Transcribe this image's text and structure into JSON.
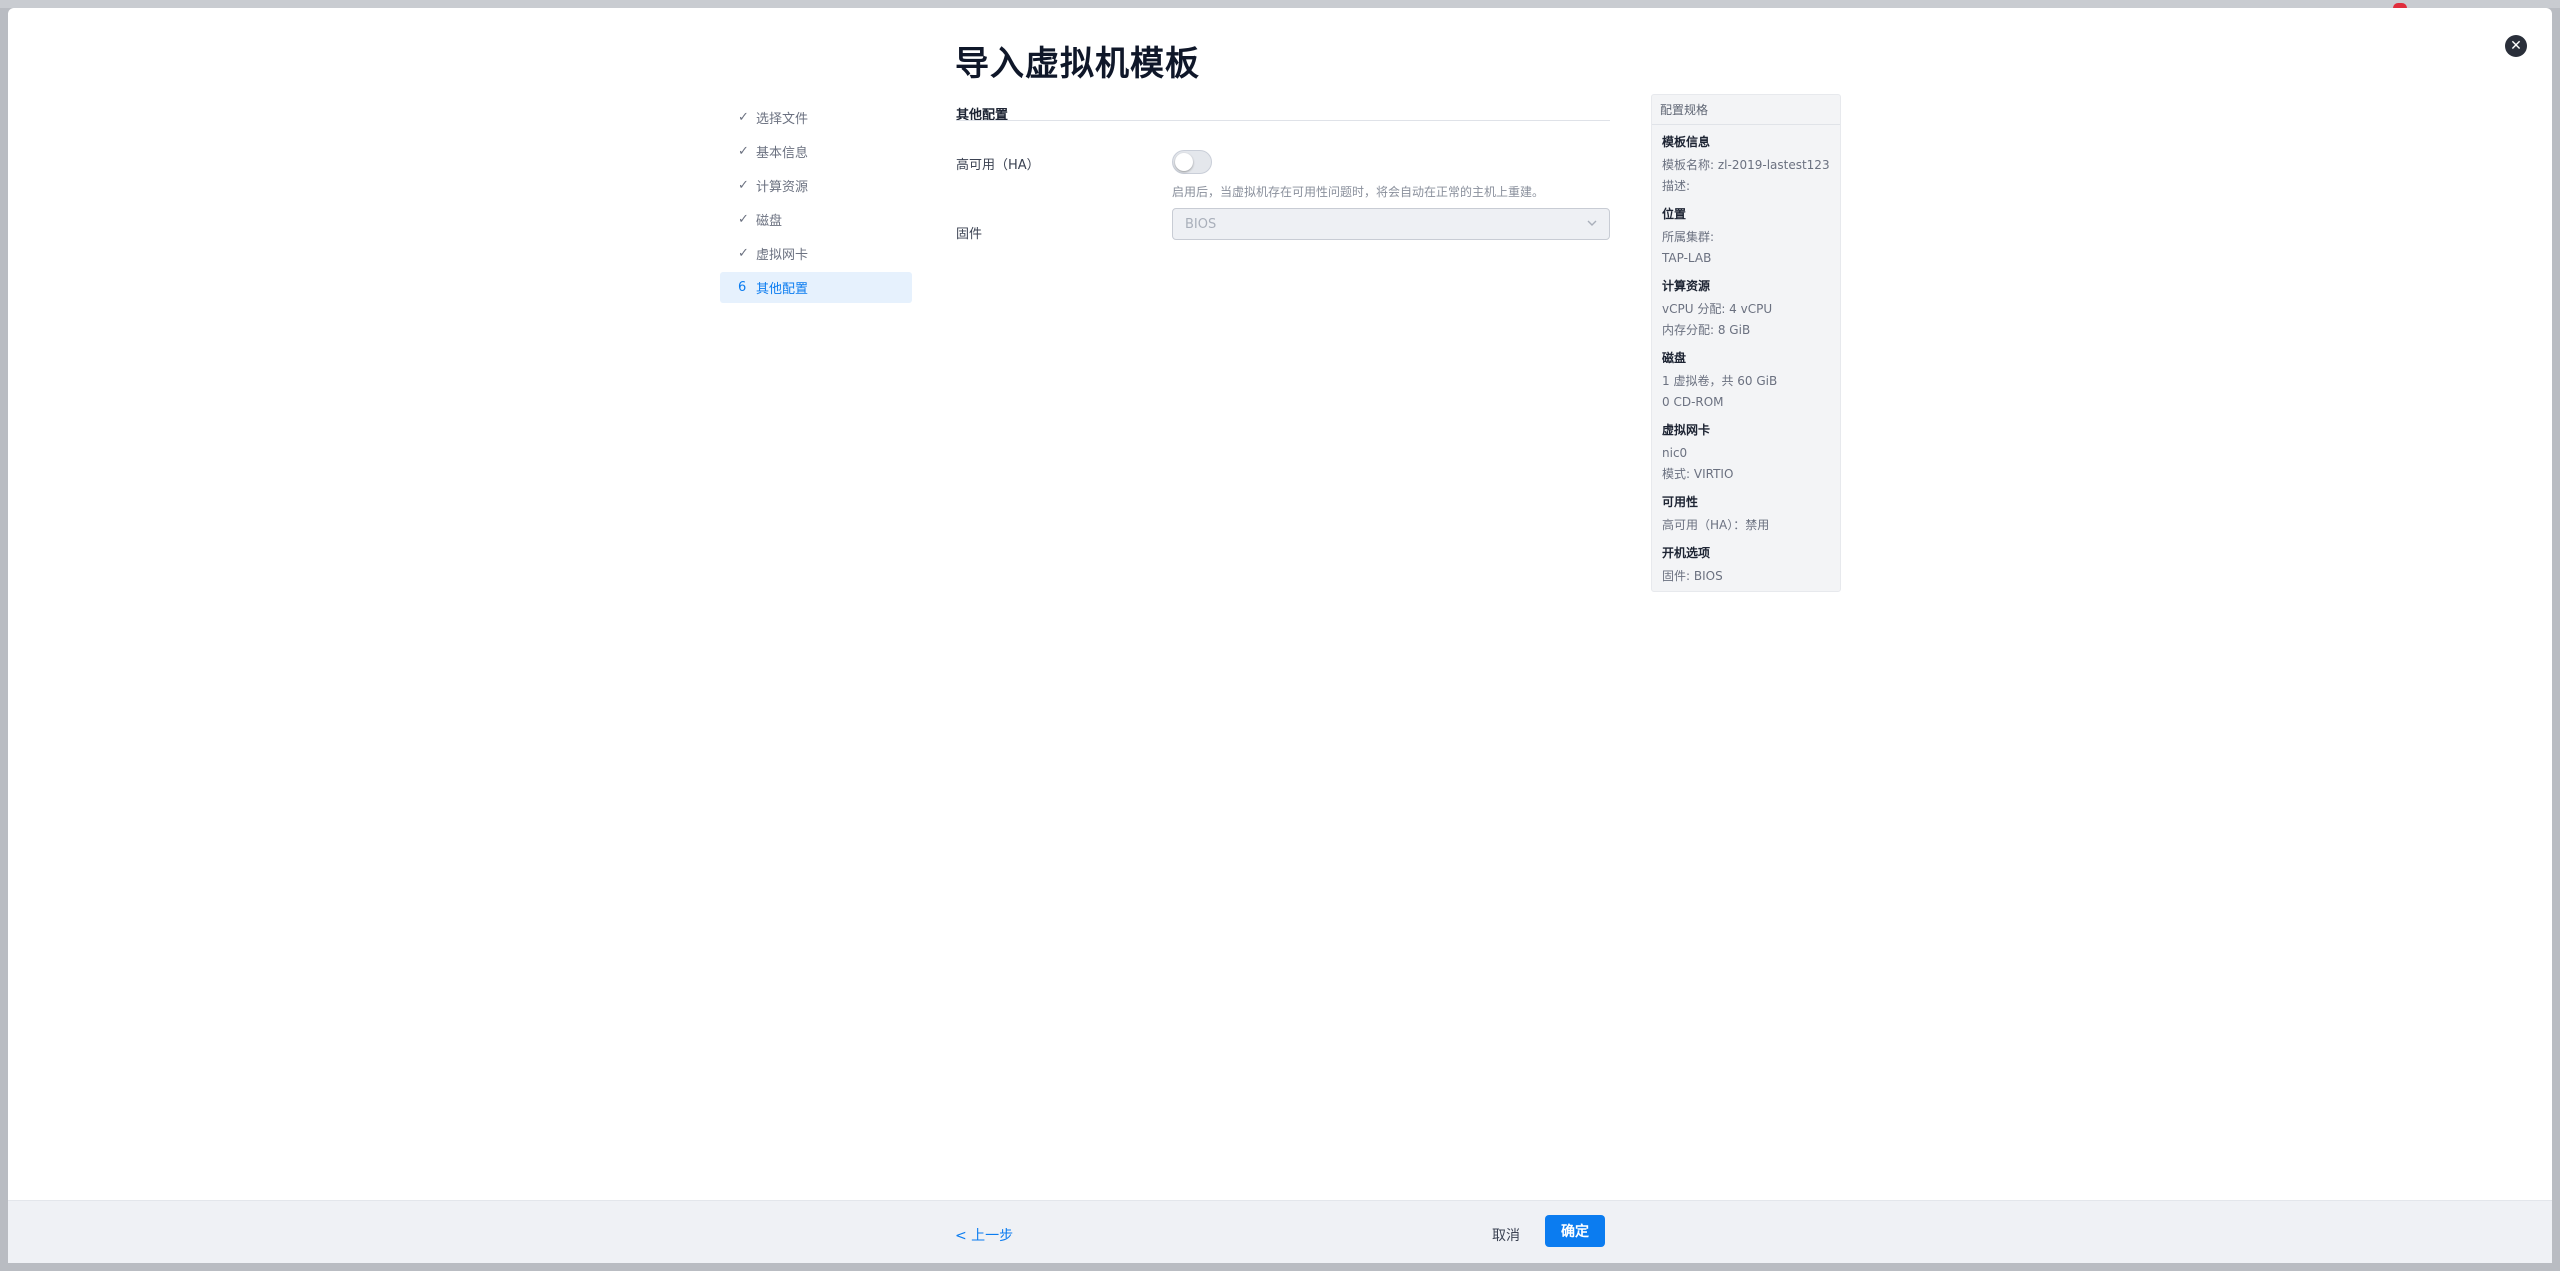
{
  "title": "导入虚拟机模板",
  "steps": [
    {
      "marker": "✓",
      "label": "选择文件"
    },
    {
      "marker": "✓",
      "label": "基本信息"
    },
    {
      "marker": "✓",
      "label": "计算资源"
    },
    {
      "marker": "✓",
      "label": "磁盘"
    },
    {
      "marker": "✓",
      "label": "虚拟网卡"
    },
    {
      "marker": "6",
      "label": "其他配置"
    }
  ],
  "form": {
    "section_title": "其他配置",
    "ha_label": "高可用（HA）",
    "ha_enabled": false,
    "ha_hint": "启用后，当虚拟机存在可用性问题时，将会自动在正常的主机上重建。",
    "firmware_label": "固件",
    "firmware_value": "BIOS"
  },
  "summary": {
    "title": "配置规格",
    "groups": [
      {
        "head": "模板信息",
        "lines": [
          "模板名称: zl-2019-lastest123",
          "描述:"
        ]
      },
      {
        "head": "位置",
        "lines": [
          "所属集群:",
          "TAP-LAB"
        ]
      },
      {
        "head": "计算资源",
        "lines": [
          "vCPU 分配: 4 vCPU",
          "内存分配: 8 GiB"
        ]
      },
      {
        "head": "磁盘",
        "lines": [
          "1 虚拟卷，共 60 GiB",
          "0 CD-ROM"
        ]
      },
      {
        "head": "虚拟网卡",
        "lines": [
          "nic0",
          "模式: VIRTIO"
        ]
      },
      {
        "head": "可用性",
        "lines": [
          "高可用（HA）：禁用"
        ]
      },
      {
        "head": "开机选项",
        "lines": [
          "固件: BIOS"
        ]
      }
    ]
  },
  "footer": {
    "prev_label": "< 上一步",
    "cancel_label": "取消",
    "ok_label": "确定"
  },
  "icons": {
    "close": "close-icon",
    "chevron": "chevron-down-icon",
    "check": "check-icon"
  },
  "colors": {
    "accent": "#0b7cf0",
    "active_step_bg": "#e6f1fd",
    "footer_bg": "#eff1f5",
    "summary_bg": "#f3f4f6"
  }
}
